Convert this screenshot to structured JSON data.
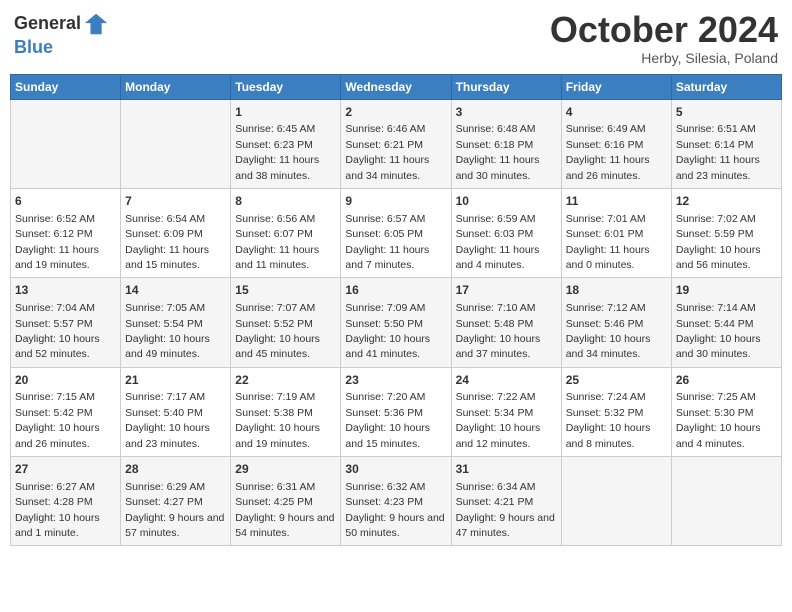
{
  "header": {
    "logo_line1": "General",
    "logo_line2": "Blue",
    "month": "October 2024",
    "location": "Herby, Silesia, Poland"
  },
  "days_of_week": [
    "Sunday",
    "Monday",
    "Tuesday",
    "Wednesday",
    "Thursday",
    "Friday",
    "Saturday"
  ],
  "weeks": [
    [
      {
        "day": "",
        "sunrise": "",
        "sunset": "",
        "daylight": ""
      },
      {
        "day": "",
        "sunrise": "",
        "sunset": "",
        "daylight": ""
      },
      {
        "day": "1",
        "sunrise": "Sunrise: 6:45 AM",
        "sunset": "Sunset: 6:23 PM",
        "daylight": "Daylight: 11 hours and 38 minutes."
      },
      {
        "day": "2",
        "sunrise": "Sunrise: 6:46 AM",
        "sunset": "Sunset: 6:21 PM",
        "daylight": "Daylight: 11 hours and 34 minutes."
      },
      {
        "day": "3",
        "sunrise": "Sunrise: 6:48 AM",
        "sunset": "Sunset: 6:18 PM",
        "daylight": "Daylight: 11 hours and 30 minutes."
      },
      {
        "day": "4",
        "sunrise": "Sunrise: 6:49 AM",
        "sunset": "Sunset: 6:16 PM",
        "daylight": "Daylight: 11 hours and 26 minutes."
      },
      {
        "day": "5",
        "sunrise": "Sunrise: 6:51 AM",
        "sunset": "Sunset: 6:14 PM",
        "daylight": "Daylight: 11 hours and 23 minutes."
      }
    ],
    [
      {
        "day": "6",
        "sunrise": "Sunrise: 6:52 AM",
        "sunset": "Sunset: 6:12 PM",
        "daylight": "Daylight: 11 hours and 19 minutes."
      },
      {
        "day": "7",
        "sunrise": "Sunrise: 6:54 AM",
        "sunset": "Sunset: 6:09 PM",
        "daylight": "Daylight: 11 hours and 15 minutes."
      },
      {
        "day": "8",
        "sunrise": "Sunrise: 6:56 AM",
        "sunset": "Sunset: 6:07 PM",
        "daylight": "Daylight: 11 hours and 11 minutes."
      },
      {
        "day": "9",
        "sunrise": "Sunrise: 6:57 AM",
        "sunset": "Sunset: 6:05 PM",
        "daylight": "Daylight: 11 hours and 7 minutes."
      },
      {
        "day": "10",
        "sunrise": "Sunrise: 6:59 AM",
        "sunset": "Sunset: 6:03 PM",
        "daylight": "Daylight: 11 hours and 4 minutes."
      },
      {
        "day": "11",
        "sunrise": "Sunrise: 7:01 AM",
        "sunset": "Sunset: 6:01 PM",
        "daylight": "Daylight: 11 hours and 0 minutes."
      },
      {
        "day": "12",
        "sunrise": "Sunrise: 7:02 AM",
        "sunset": "Sunset: 5:59 PM",
        "daylight": "Daylight: 10 hours and 56 minutes."
      }
    ],
    [
      {
        "day": "13",
        "sunrise": "Sunrise: 7:04 AM",
        "sunset": "Sunset: 5:57 PM",
        "daylight": "Daylight: 10 hours and 52 minutes."
      },
      {
        "day": "14",
        "sunrise": "Sunrise: 7:05 AM",
        "sunset": "Sunset: 5:54 PM",
        "daylight": "Daylight: 10 hours and 49 minutes."
      },
      {
        "day": "15",
        "sunrise": "Sunrise: 7:07 AM",
        "sunset": "Sunset: 5:52 PM",
        "daylight": "Daylight: 10 hours and 45 minutes."
      },
      {
        "day": "16",
        "sunrise": "Sunrise: 7:09 AM",
        "sunset": "Sunset: 5:50 PM",
        "daylight": "Daylight: 10 hours and 41 minutes."
      },
      {
        "day": "17",
        "sunrise": "Sunrise: 7:10 AM",
        "sunset": "Sunset: 5:48 PM",
        "daylight": "Daylight: 10 hours and 37 minutes."
      },
      {
        "day": "18",
        "sunrise": "Sunrise: 7:12 AM",
        "sunset": "Sunset: 5:46 PM",
        "daylight": "Daylight: 10 hours and 34 minutes."
      },
      {
        "day": "19",
        "sunrise": "Sunrise: 7:14 AM",
        "sunset": "Sunset: 5:44 PM",
        "daylight": "Daylight: 10 hours and 30 minutes."
      }
    ],
    [
      {
        "day": "20",
        "sunrise": "Sunrise: 7:15 AM",
        "sunset": "Sunset: 5:42 PM",
        "daylight": "Daylight: 10 hours and 26 minutes."
      },
      {
        "day": "21",
        "sunrise": "Sunrise: 7:17 AM",
        "sunset": "Sunset: 5:40 PM",
        "daylight": "Daylight: 10 hours and 23 minutes."
      },
      {
        "day": "22",
        "sunrise": "Sunrise: 7:19 AM",
        "sunset": "Sunset: 5:38 PM",
        "daylight": "Daylight: 10 hours and 19 minutes."
      },
      {
        "day": "23",
        "sunrise": "Sunrise: 7:20 AM",
        "sunset": "Sunset: 5:36 PM",
        "daylight": "Daylight: 10 hours and 15 minutes."
      },
      {
        "day": "24",
        "sunrise": "Sunrise: 7:22 AM",
        "sunset": "Sunset: 5:34 PM",
        "daylight": "Daylight: 10 hours and 12 minutes."
      },
      {
        "day": "25",
        "sunrise": "Sunrise: 7:24 AM",
        "sunset": "Sunset: 5:32 PM",
        "daylight": "Daylight: 10 hours and 8 minutes."
      },
      {
        "day": "26",
        "sunrise": "Sunrise: 7:25 AM",
        "sunset": "Sunset: 5:30 PM",
        "daylight": "Daylight: 10 hours and 4 minutes."
      }
    ],
    [
      {
        "day": "27",
        "sunrise": "Sunrise: 6:27 AM",
        "sunset": "Sunset: 4:28 PM",
        "daylight": "Daylight: 10 hours and 1 minute."
      },
      {
        "day": "28",
        "sunrise": "Sunrise: 6:29 AM",
        "sunset": "Sunset: 4:27 PM",
        "daylight": "Daylight: 9 hours and 57 minutes."
      },
      {
        "day": "29",
        "sunrise": "Sunrise: 6:31 AM",
        "sunset": "Sunset: 4:25 PM",
        "daylight": "Daylight: 9 hours and 54 minutes."
      },
      {
        "day": "30",
        "sunrise": "Sunrise: 6:32 AM",
        "sunset": "Sunset: 4:23 PM",
        "daylight": "Daylight: 9 hours and 50 minutes."
      },
      {
        "day": "31",
        "sunrise": "Sunrise: 6:34 AM",
        "sunset": "Sunset: 4:21 PM",
        "daylight": "Daylight: 9 hours and 47 minutes."
      },
      {
        "day": "",
        "sunrise": "",
        "sunset": "",
        "daylight": ""
      },
      {
        "day": "",
        "sunrise": "",
        "sunset": "",
        "daylight": ""
      }
    ]
  ]
}
